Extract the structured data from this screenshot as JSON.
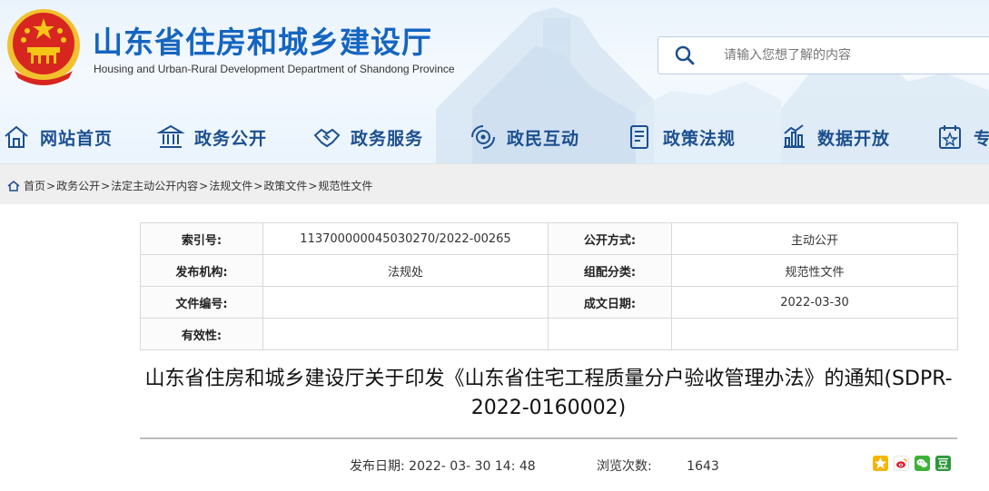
{
  "header": {
    "title": "山东省住房和城乡建设厅",
    "subtitle": "Housing and Urban-Rural Development Department of Shandong Province",
    "search_placeholder": "请输入您想了解的内容"
  },
  "nav": {
    "items": [
      {
        "label": "网站首页",
        "icon": "home-icon"
      },
      {
        "label": "政务公开",
        "icon": "government-building-icon"
      },
      {
        "label": "政务服务",
        "icon": "handshake-icon"
      },
      {
        "label": "政民互动",
        "icon": "interaction-icon"
      },
      {
        "label": "政策法规",
        "icon": "document-icon"
      },
      {
        "label": "数据开放",
        "icon": "bar-chart-icon"
      },
      {
        "label": "专",
        "icon": "calendar-icon"
      }
    ]
  },
  "breadcrumb": [
    "首页",
    "政务公开",
    "法定主动公开内容",
    "法规文件",
    "政策文件",
    "规范性文件"
  ],
  "meta": {
    "index_label": "索引号:",
    "index_value": "113700000045030270/2022-00265",
    "public_label": "公开方式:",
    "public_value": "主动公开",
    "issuer_label": "发布机构:",
    "issuer_value": "法规处",
    "category_label": "组配分类:",
    "category_value": "规范性文件",
    "docno_label": "文件编号:",
    "docno_value": "",
    "date_label": "成文日期:",
    "date_value": "2022-03-30",
    "validity_label": "有效性:",
    "validity_value": ""
  },
  "article": {
    "title": "山东省住房和城乡建设厅关于印发《山东省住宅工程质量分户验收管理办法》的通知(SDPR-2022-0160002)",
    "publish_label": "发布日期:",
    "publish_value": "2022- 03- 30 14: 48",
    "views_label": "浏览次数:",
    "views_value": "1643"
  },
  "share_icons": [
    "qzone-icon",
    "weibo-icon",
    "wechat-icon",
    "douban-icon"
  ],
  "colors": {
    "brand": "#1565c0",
    "nav": "#1c4f8f",
    "emblem_red": "#d7261f",
    "emblem_gold": "#f5c518"
  }
}
